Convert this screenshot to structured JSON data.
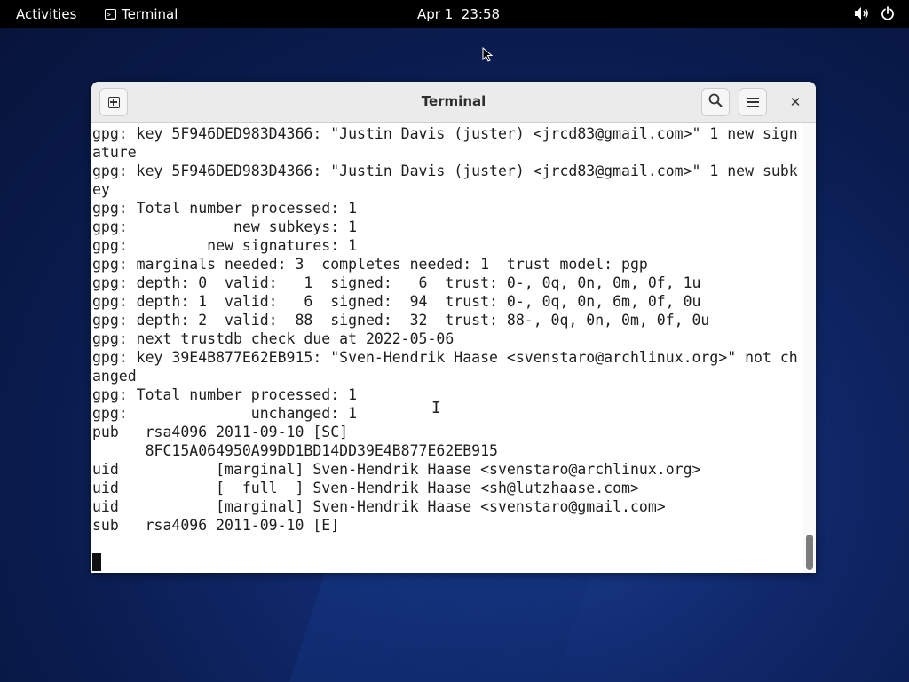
{
  "topbar": {
    "activities": "Activities",
    "app_name": "Terminal",
    "clock": "Apr 1  23:58",
    "icons": [
      "volume-icon",
      "power-icon"
    ]
  },
  "window": {
    "title": "Terminal",
    "icons": [
      "new-tab-icon",
      "search-icon",
      "hamburger-menu-icon",
      "close-icon"
    ]
  },
  "terminal": {
    "lines": [
      "gpg: key 5F946DED983D4366: \"Justin Davis (juster) <jrcd83@gmail.com>\" 1 new sign",
      "ature",
      "gpg: key 5F946DED983D4366: \"Justin Davis (juster) <jrcd83@gmail.com>\" 1 new subk",
      "ey",
      "gpg: Total number processed: 1",
      "gpg:            new subkeys: 1",
      "gpg:         new signatures: 1",
      "gpg: marginals needed: 3  completes needed: 1  trust model: pgp",
      "gpg: depth: 0  valid:   1  signed:   6  trust: 0-, 0q, 0n, 0m, 0f, 1u",
      "gpg: depth: 1  valid:   6  signed:  94  trust: 0-, 0q, 0n, 6m, 0f, 0u",
      "gpg: depth: 2  valid:  88  signed:  32  trust: 88-, 0q, 0n, 0m, 0f, 0u",
      "gpg: next trustdb check due at 2022-05-06",
      "gpg: key 39E4B877E62EB915: \"Sven-Hendrik Haase <svenstaro@archlinux.org>\" not ch",
      "anged",
      "gpg: Total number processed: 1",
      "gpg:              unchanged: 1",
      "pub   rsa4096 2011-09-10 [SC]",
      "      8FC15A064950A99DD1BD14DD39E4B877E62EB915",
      "uid           [marginal] Sven-Hendrik Haase <svenstaro@archlinux.org>",
      "uid           [  full  ] Sven-Hendrik Haase <sh@lutzhaase.com>",
      "uid           [marginal] Sven-Hendrik Haase <svenstaro@gmail.com>",
      "sub   rsa4096 2011-09-10 [E]"
    ]
  }
}
